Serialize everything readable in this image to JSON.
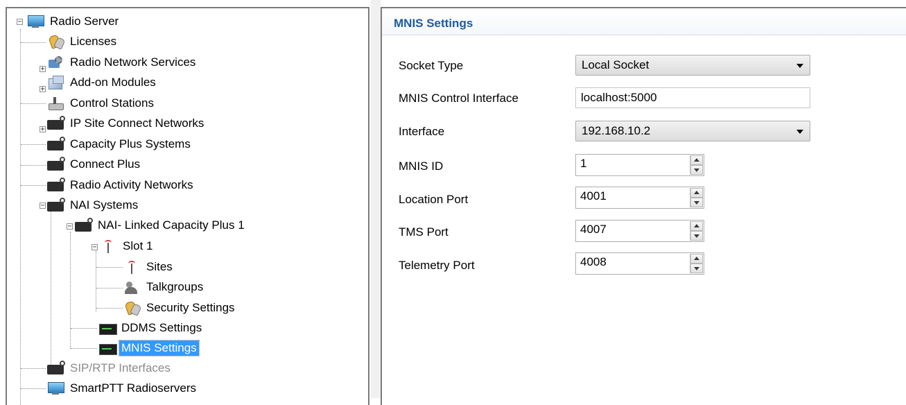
{
  "tree": {
    "items": [
      {
        "label": "Radio Server",
        "icon": "monitor-icon"
      },
      {
        "label": "Licenses",
        "icon": "keys-icon"
      },
      {
        "label": "Radio Network Services",
        "icon": "gear-icon"
      },
      {
        "label": "Add-on Modules",
        "icon": "addon-icon"
      },
      {
        "label": "Control Stations",
        "icon": "control-station-icon"
      },
      {
        "label": "IP Site Connect Networks",
        "icon": "radio-icon"
      },
      {
        "label": "Capacity Plus Systems",
        "icon": "radio-icon"
      },
      {
        "label": "Connect Plus",
        "icon": "radio-icon"
      },
      {
        "label": "Radio Activity Networks",
        "icon": "radio-icon"
      },
      {
        "label": "NAI Systems",
        "icon": "radio-icon"
      },
      {
        "label": "NAI- Linked Capacity Plus 1",
        "icon": "radio-icon"
      },
      {
        "label": "Slot 1",
        "icon": "antenna-icon"
      },
      {
        "label": "Sites",
        "icon": "antenna-icon"
      },
      {
        "label": "Talkgroups",
        "icon": "people-icon"
      },
      {
        "label": "Security Settings",
        "icon": "keys-icon"
      },
      {
        "label": "DDMS Settings",
        "icon": "console-icon"
      },
      {
        "label": "MNIS Settings",
        "icon": "console-icon"
      },
      {
        "label": "SIP/RTP Interfaces",
        "icon": "radio-icon"
      },
      {
        "label": "SmartPTT Radioservers",
        "icon": "monitor-icon"
      }
    ]
  },
  "settings": {
    "title": "MNIS Settings",
    "socket_type": {
      "label": "Socket Type",
      "value": "Local Socket"
    },
    "control_interface": {
      "label": "MNIS Control Interface",
      "value": "localhost:5000"
    },
    "interface": {
      "label": "Interface",
      "value": "192.168.10.2"
    },
    "mnis_id": {
      "label": "MNIS ID",
      "value": "1"
    },
    "location_port": {
      "label": "Location Port",
      "value": "4001"
    },
    "tms_port": {
      "label": "TMS Port",
      "value": "4007"
    },
    "telemetry_port": {
      "label": "Telemetry Port",
      "value": "4008"
    }
  },
  "colors": {
    "selection": "#3399ff",
    "header_title": "#1e5a9e"
  }
}
